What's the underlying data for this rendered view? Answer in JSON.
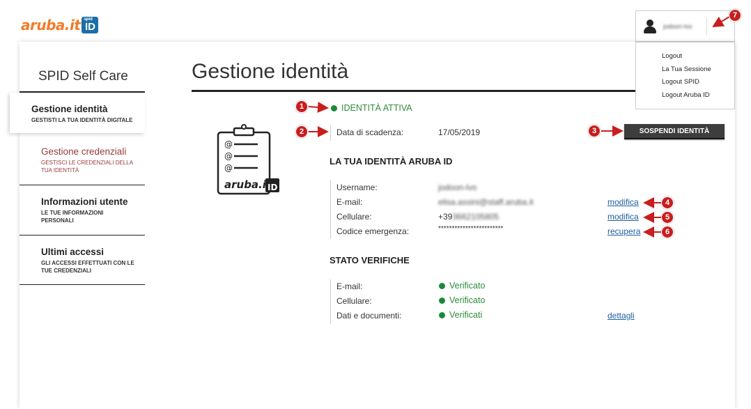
{
  "header": {
    "logo_word": "aruba.it",
    "logo_sup": "spid",
    "logo_id": "ID",
    "username": "jodoon-lvo",
    "chevron": "⌃"
  },
  "dropdown": {
    "items": [
      "Logout",
      "La Tua Sessione",
      "Logout SPID",
      "Logout Aruba ID"
    ]
  },
  "sidebar": {
    "title": "SPID Self Care",
    "items": [
      {
        "title": "Gestione identità",
        "sub": "GESTISTI LA TUA IDENTITÀ DIGITALE"
      },
      {
        "title": "Gestione credenziali",
        "sub": "GESTISCI LE CREDENZIALI DELLA TUA IDENTITÀ"
      },
      {
        "title": "Informazioni utente",
        "sub": "LE TUE INFORMAZIONI PERSONALI"
      },
      {
        "title": "Ultimi accessi",
        "sub": "GLI ACCESSI EFFETTUATI CON LE TUE CREDENZIALI"
      }
    ]
  },
  "main": {
    "title": "Gestione identità",
    "status": "IDENTITÀ ATTIVA",
    "expiry_label": "Data di scadenza:",
    "expiry_value": "17/05/2019",
    "suspend_button": "SOSPENDI IDENTITÀ",
    "identity_section": {
      "title": "LA TUA IDENTITÀ ARUBA ID",
      "rows": [
        {
          "label": "Username:",
          "value": "jodoon-lvo",
          "link": ""
        },
        {
          "label": "E-mail:",
          "value": "elisa.assini@staff.aruba.it",
          "link": "modifica"
        },
        {
          "label": "Cellulare:",
          "value_prefix": "+39",
          "value": "3662105805",
          "link": "modifica"
        },
        {
          "label": "Codice emergenza:",
          "value": "************************",
          "link": "recupera"
        }
      ]
    },
    "verification_section": {
      "title": "STATO VERIFICHE",
      "rows": [
        {
          "label": "E-mail:",
          "value": "Verificato",
          "link": ""
        },
        {
          "label": "Cellulare:",
          "value": "Verificato",
          "link": ""
        },
        {
          "label": "Dati e documenti:",
          "value": "Verificati",
          "link": "dettagli"
        }
      ]
    }
  },
  "annotations": [
    "1",
    "2",
    "3",
    "4",
    "5",
    "6",
    "7"
  ],
  "colors": {
    "accent_red": "#c81e1e",
    "status_green": "#2e8b3a",
    "link_blue": "#1d5fa0",
    "logo_orange": "#f07c28",
    "logo_blue": "#1b6ea8",
    "button_dark": "#3d3d3d"
  }
}
